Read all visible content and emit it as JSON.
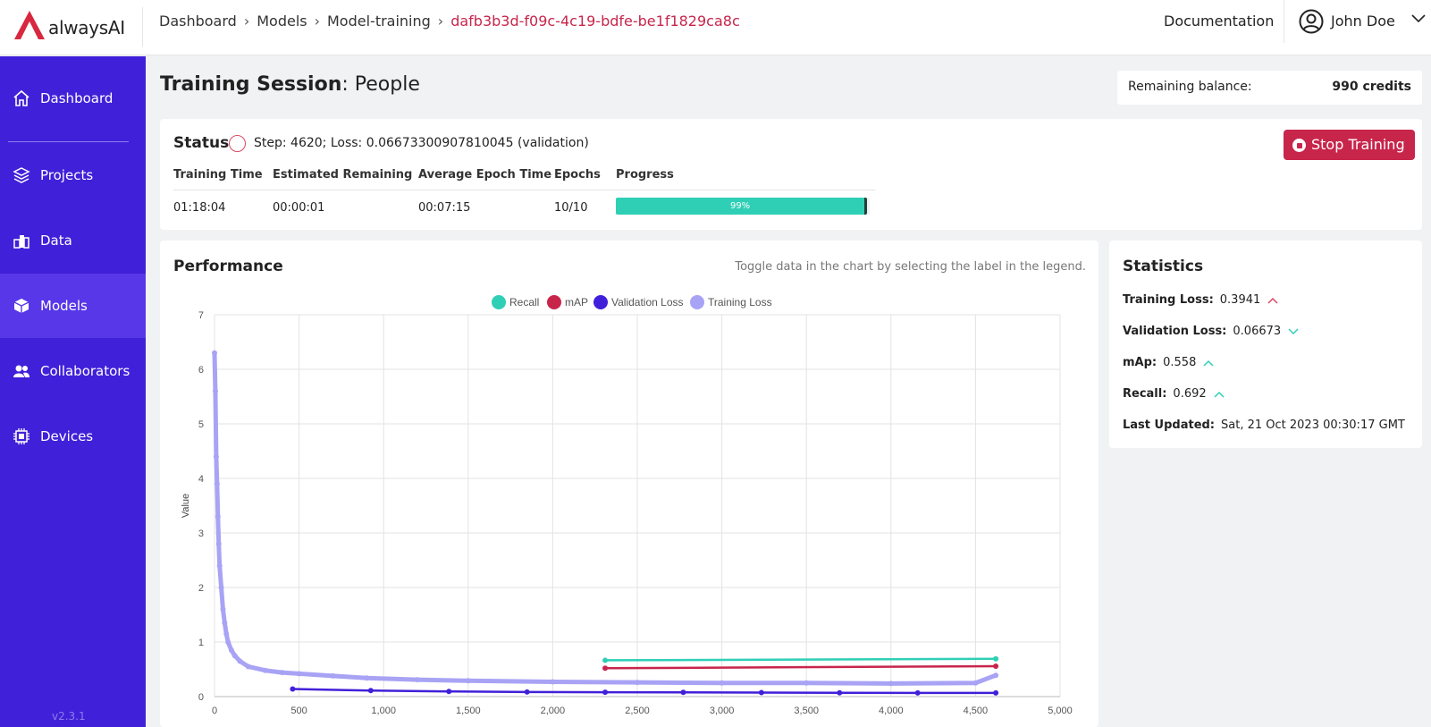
{
  "brand": {
    "name": "alwaysAI",
    "accent": "#c8254b",
    "sidebar_bg": "#4120d9"
  },
  "breadcrumb": [
    "Dashboard",
    "Models",
    "Model-training",
    "dafb3b3d-f09c-4c19-bdfe-be1f1829ca8c"
  ],
  "header": {
    "documentation": "Documentation",
    "user_name": "John Doe"
  },
  "sidebar": {
    "items": [
      {
        "label": "Dashboard",
        "icon": "home-icon"
      },
      {
        "label": "Projects",
        "icon": "layers-icon"
      },
      {
        "label": "Data",
        "icon": "data-blocks-icon"
      },
      {
        "label": "Models",
        "icon": "cube-icon"
      },
      {
        "label": "Collaborators",
        "icon": "users-icon"
      },
      {
        "label": "Devices",
        "icon": "chip-icon"
      }
    ],
    "active": "Models",
    "version": "v2.3.1"
  },
  "page": {
    "title_bold": "Training Session",
    "title_rest": ": People"
  },
  "balance": {
    "label": "Remaining balance:",
    "value": "990 credits"
  },
  "status": {
    "title": "Status",
    "text": "Step: 4620; Loss: 0.06673300907810045 (validation)",
    "stop_label": "Stop Training",
    "columns": {
      "training_time": {
        "label": "Training Time",
        "value": "01:18:04"
      },
      "estimated_remaining": {
        "label": "Estimated Remaining",
        "value": "00:00:01"
      },
      "average_epoch_time": {
        "label": "Average Epoch Time",
        "value": "00:07:15"
      },
      "epochs": {
        "label": "Epochs",
        "value": "10/10"
      },
      "progress": {
        "label": "Progress",
        "value": 99,
        "value_text": "99%"
      }
    }
  },
  "performance": {
    "title": "Performance",
    "hint": "Toggle data in the chart by selecting the label in the legend."
  },
  "statistics": {
    "title": "Statistics",
    "rows": [
      {
        "label": "Training Loss:",
        "value": "0.3941",
        "trend": "up",
        "trend_color": "#d84a63"
      },
      {
        "label": "Validation Loss:",
        "value": "0.06673",
        "trend": "down",
        "trend_color": "#2fcfb6"
      },
      {
        "label": "mAp:",
        "value": "0.558",
        "trend": "up",
        "trend_color": "#2fcfb6"
      },
      {
        "label": "Recall:",
        "value": "0.692",
        "trend": "up",
        "trend_color": "#2fcfb6"
      },
      {
        "label": "Last Updated:",
        "value": "Sat, 21 Oct 2023 00:30:17 GMT"
      }
    ]
  },
  "chart_data": {
    "type": "line",
    "ylabel": "Value",
    "xlim": [
      0,
      5000
    ],
    "ylim": [
      0,
      7
    ],
    "x_ticks": [
      "0",
      "500",
      "1,000",
      "1,500",
      "2,000",
      "2,500",
      "3,000",
      "3,500",
      "4,000",
      "4,500",
      "5,000"
    ],
    "y_ticks": [
      "0",
      "1",
      "2",
      "3",
      "4",
      "5",
      "6",
      "7"
    ],
    "grid": true,
    "legend": "top-center",
    "series": [
      {
        "name": "Recall",
        "color": "#2fcfb6",
        "x": [
          2310,
          4620
        ],
        "y": [
          0.665,
          0.692
        ]
      },
      {
        "name": "mAP",
        "color": "#c8254b",
        "x": [
          2310,
          4620
        ],
        "y": [
          0.52,
          0.558
        ]
      },
      {
        "name": "Validation Loss",
        "color": "#4120d9",
        "x": [
          462,
          924,
          1386,
          1848,
          2310,
          2772,
          3234,
          3696,
          4158,
          4620
        ],
        "y": [
          0.14,
          0.11,
          0.095,
          0.085,
          0.08,
          0.077,
          0.073,
          0.07,
          0.068,
          0.067
        ]
      },
      {
        "name": "Training Loss",
        "color": "#a9a3f5",
        "x": [
          0,
          5,
          10,
          15,
          20,
          25,
          30,
          40,
          50,
          60,
          70,
          80,
          100,
          120,
          150,
          200,
          300,
          400,
          500,
          700,
          900,
          1200,
          1500,
          2000,
          2500,
          3000,
          3500,
          4000,
          4500,
          4620
        ],
        "y": [
          6.3,
          5.6,
          4.4,
          3.9,
          3.3,
          2.8,
          2.4,
          2.0,
          1.6,
          1.35,
          1.15,
          1.0,
          0.85,
          0.75,
          0.65,
          0.55,
          0.48,
          0.44,
          0.42,
          0.38,
          0.34,
          0.31,
          0.29,
          0.27,
          0.26,
          0.25,
          0.25,
          0.24,
          0.25,
          0.39
        ]
      }
    ]
  }
}
